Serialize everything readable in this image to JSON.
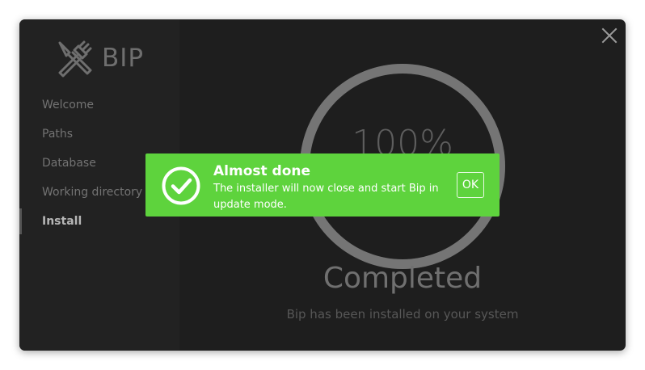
{
  "app": {
    "name": "BIP",
    "logo_icon": "fork-and-knife-crossed-icon"
  },
  "sidebar": {
    "items": [
      {
        "label": "Welcome",
        "active": false
      },
      {
        "label": "Paths",
        "active": false
      },
      {
        "label": "Database",
        "active": false
      },
      {
        "label": "Working directory",
        "active": false
      },
      {
        "label": "Install",
        "active": true
      }
    ]
  },
  "main": {
    "progress_percent": 100,
    "progress_label": "100%",
    "status_title": "Completed",
    "status_subtitle": "Bip has been installed on your system"
  },
  "toast": {
    "title": "Almost done",
    "message": "The installer will now close and start Bip in update mode.",
    "ok_label": "OK",
    "icon": "check-circle-icon"
  },
  "colors": {
    "window_bg": "#1e1e1e",
    "sidebar_bg": "#222222",
    "toast_bg": "#5ed33d",
    "ring": "#757575"
  }
}
